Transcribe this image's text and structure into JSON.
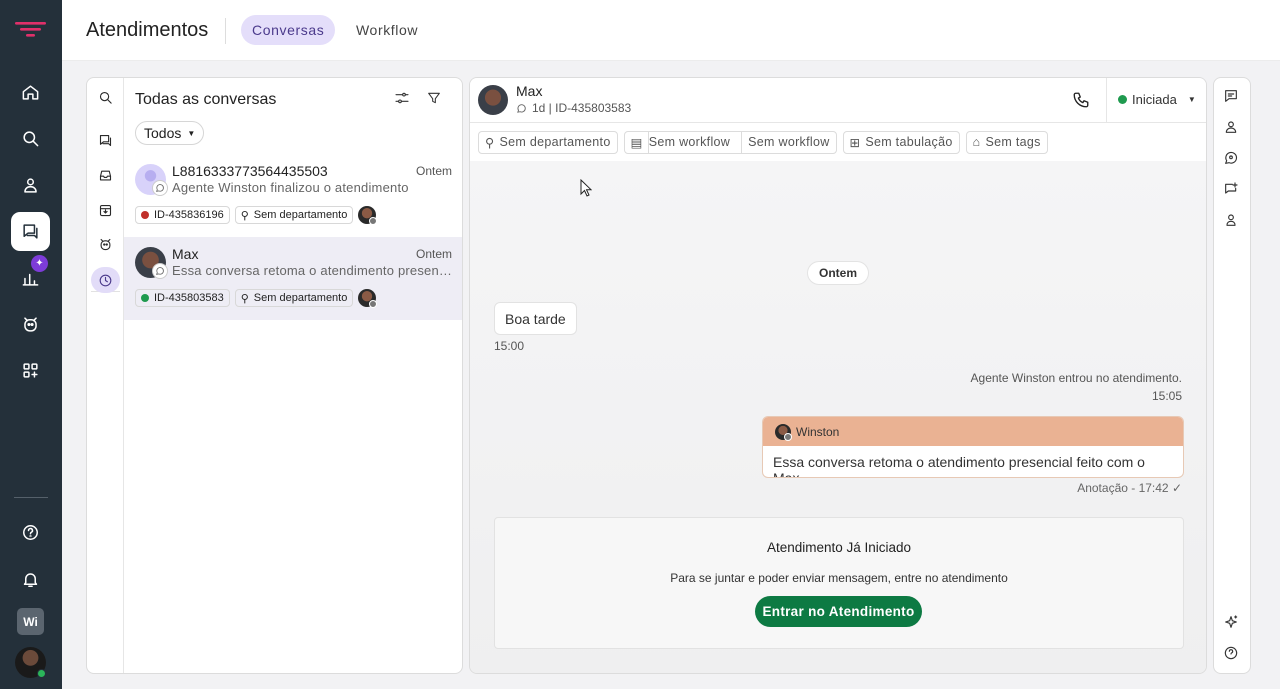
{
  "app": {
    "title": "Atendimentos"
  },
  "tabs": [
    {
      "label": "Conversas",
      "active": true
    },
    {
      "label": "Workflow",
      "active": false
    }
  ],
  "rail": {
    "avatar_initials": "Wi",
    "badge": "✦"
  },
  "list": {
    "title": "Todas as conversas",
    "filter_label": "Todos",
    "conversations": [
      {
        "name": "L8816333773564435503",
        "time": "Ontem",
        "preview": "Agente Winston finalizou o atendimento",
        "id": "ID-435836196",
        "department": "Sem departamento",
        "status_color": "#c0302a"
      },
      {
        "name": "Max",
        "time": "Ontem",
        "preview": "Essa conversa retoma o atendimento presencial feito com o Max",
        "id": "ID-435803583",
        "department": "Sem departamento",
        "status_color": "#1f9a4f"
      }
    ]
  },
  "chat": {
    "contact_name": "Max",
    "contact_sub": "1d | ID-435803583",
    "status": "Iniciada",
    "status_color": "#1f9a4f",
    "tags": {
      "department": "Sem departamento",
      "workflow1": "Sem workflow",
      "workflow2": "Sem workflow",
      "tabulation": "Sem tabulação",
      "tags": "Sem tags"
    },
    "date_divider": "Ontem",
    "incoming": {
      "text": "Boa tarde",
      "time": "15:00"
    },
    "system": {
      "text": "Agente Winston entrou no atendimento.",
      "time": "15:05"
    },
    "note": {
      "author": "Winston",
      "text": "Essa conversa retoma o atendimento presencial feito com o Max",
      "meta": "Anotação - 17:42 ✓"
    },
    "join": {
      "title": "Atendimento Já Iniciado",
      "desc": "Para se juntar e poder enviar mensagem, entre no atendimento",
      "button": "Entrar no Atendimento",
      "button_color": "#0d7a43"
    }
  },
  "colors": {
    "rail": "#24303a",
    "accent": "#4b3a8c",
    "note_header": "#eab293"
  }
}
